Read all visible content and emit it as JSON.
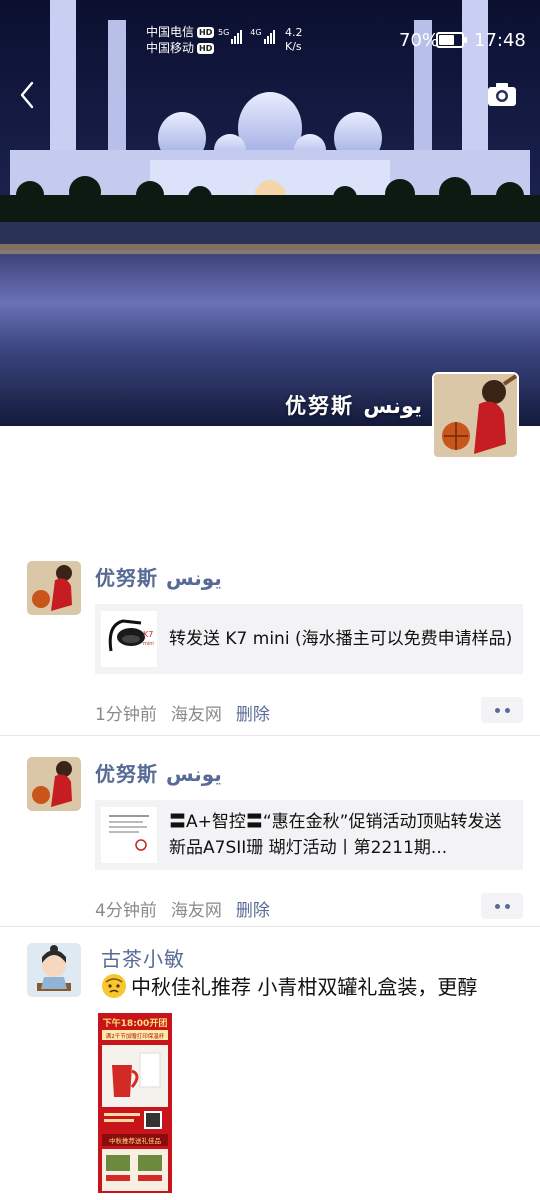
{
  "status_bar": {
    "carrier_1": "中国电信",
    "carrier_2": "中国移动",
    "hd": "HD",
    "net_1": "5G",
    "net_2": "4G",
    "speed_value": "4.2",
    "speed_unit": "K/s",
    "battery": "70%",
    "battery_level": 0.7,
    "time": "17:48"
  },
  "header": {
    "back_icon": "chevron-left-icon",
    "camera_icon": "camera-icon",
    "profile_name": "优努斯 يونس"
  },
  "posts": [
    {
      "author": "优努斯 يونس",
      "share_text": "转发送 K7 mini (海水播主可以免费申请样品)",
      "time": "1分钟前",
      "source": "海友网",
      "delete": "删除",
      "thumb_label": "K7",
      "thumb_sub": "mini"
    },
    {
      "author": "优努斯 يونس",
      "share_text": "〓A+智控〓“惠在金秋”促销活动顶贴转发送新品A7SII珊 瑚灯活动丨第2211期...",
      "time": "4分钟前",
      "source": "海友网",
      "delete": "删除"
    },
    {
      "author": "古茶小敏",
      "text": "中秋佳礼推荐 小青柑双罐礼盒装，更醇",
      "poster_title": "下午18:00开团",
      "poster_sub": "满2千节加赠打印保温杯",
      "poster_band": "中秋推荐送礼佳品"
    }
  ]
}
